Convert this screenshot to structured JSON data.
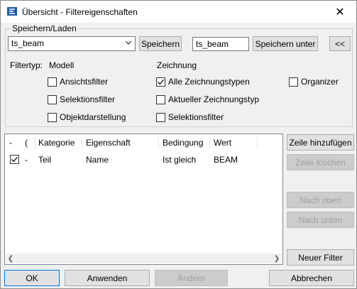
{
  "window": {
    "title": "Übersicht - Filtereigenschaften",
    "close_glyph": "✕"
  },
  "save_load": {
    "group_label": "Speichern/Laden",
    "combo_value": "ts_beam",
    "save_button": "Speichern",
    "name_value": "ts_beam",
    "save_as_button": "Speichern unter",
    "collapse_button": "<<"
  },
  "filter_type": {
    "label": "Filtertyp:",
    "model_heading": "Modell",
    "drawing_heading": "Zeichnung",
    "model_options": [
      {
        "label": "Ansichtsfilter",
        "checked": false
      },
      {
        "label": "Selektionsfilter",
        "checked": false
      },
      {
        "label": "Objektdarstellung",
        "checked": false
      }
    ],
    "drawing_options": [
      {
        "label": "Alle Zeichnungstypen",
        "checked": true
      },
      {
        "label": "Aktueller Zeichnungstyp",
        "checked": false
      },
      {
        "label": "Selektionsfilter",
        "checked": false
      }
    ],
    "organizer": {
      "label": "Organizer",
      "checked": false
    }
  },
  "table": {
    "headers": [
      "-",
      "(",
      "Kategorie",
      "Eigenschaft",
      "Bedingung",
      "Wert"
    ],
    "rows": [
      {
        "checked": true,
        "dash": "-",
        "kategorie": "Teil",
        "eigenschaft": "Name",
        "bedingung": "Ist gleich",
        "wert": "BEAM"
      }
    ]
  },
  "side_buttons": {
    "add_row": "Zeile hinzufügen",
    "delete_row": "Zeile löschen",
    "move_up": "Nach oben",
    "move_down": "Nach unten",
    "new_filter": "Neuer Filter"
  },
  "footer": {
    "ok": "OK",
    "apply": "Anwenden",
    "change": "Ändern",
    "cancel": "Abbrechen"
  },
  "colors": {
    "focus_border": "#0078d7",
    "disabled_text": "#a0a0a0"
  }
}
